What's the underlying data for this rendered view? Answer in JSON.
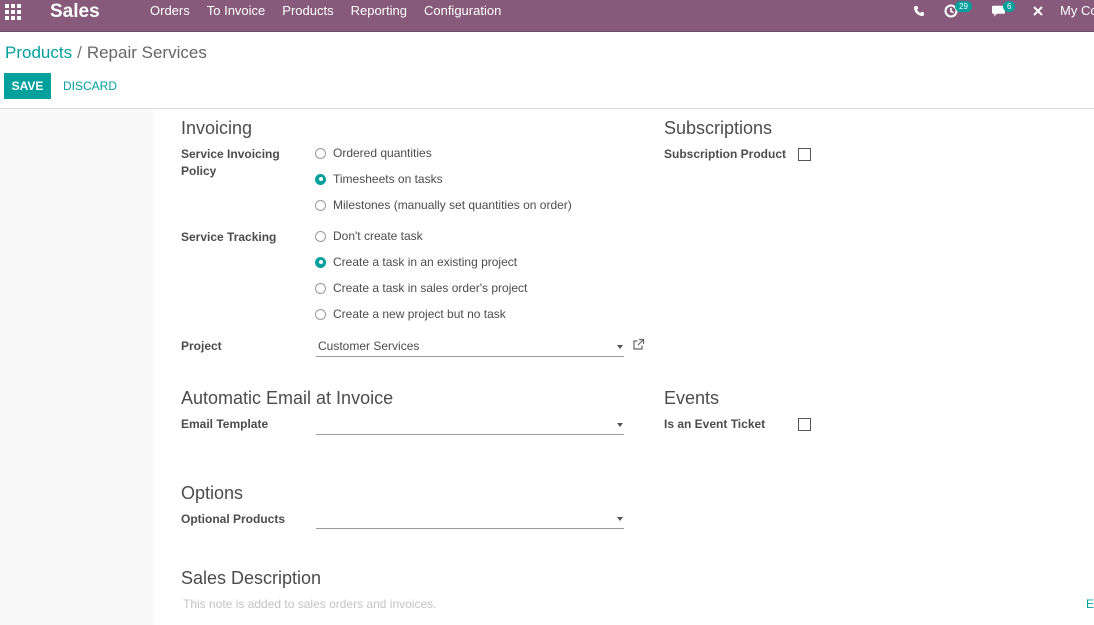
{
  "navbar": {
    "app_name": "Sales",
    "menu": [
      "Orders",
      "To Invoice",
      "Products",
      "Reporting",
      "Configuration"
    ],
    "activity_count": "29",
    "message_count": "6",
    "company": "My Co"
  },
  "breadcrumb": {
    "parent": "Products",
    "separator": "/",
    "current": "Repair Services"
  },
  "actions": {
    "save": "SAVE",
    "discard": "DISCARD"
  },
  "invoicing": {
    "title": "Invoicing",
    "policy_label": "Service Invoicing Policy",
    "policy_options": [
      {
        "label": "Ordered quantities",
        "checked": false
      },
      {
        "label": "Timesheets on tasks",
        "checked": true
      },
      {
        "label": "Milestones (manually set quantities on order)",
        "checked": false
      }
    ],
    "tracking_label": "Service Tracking",
    "tracking_options": [
      {
        "label": "Don't create task",
        "checked": false
      },
      {
        "label": "Create a task in an existing project",
        "checked": true
      },
      {
        "label": "Create a task in sales order's project",
        "checked": false
      },
      {
        "label": "Create a new project but no task",
        "checked": false
      }
    ],
    "project_label": "Project",
    "project_value": "Customer Services"
  },
  "subscriptions": {
    "title": "Subscriptions",
    "label": "Subscription Product",
    "checked": false
  },
  "email": {
    "title": "Automatic Email at Invoice",
    "template_label": "Email Template",
    "template_value": ""
  },
  "events": {
    "title": "Events",
    "label": "Is an Event Ticket",
    "checked": false
  },
  "options": {
    "title": "Options",
    "label": "Optional Products",
    "value": ""
  },
  "sales_description": {
    "title": "Sales Description",
    "placeholder": "This note is added to sales orders and invoices.",
    "edge_text": "E"
  },
  "colors": {
    "navbar": "#875a7b",
    "accent": "#00a09d"
  },
  "icons": [
    "apps-grid-icon",
    "phone-icon",
    "activity-clock-icon",
    "chat-icon",
    "close-icon",
    "external-link-icon",
    "dropdown-caret-icon"
  ]
}
